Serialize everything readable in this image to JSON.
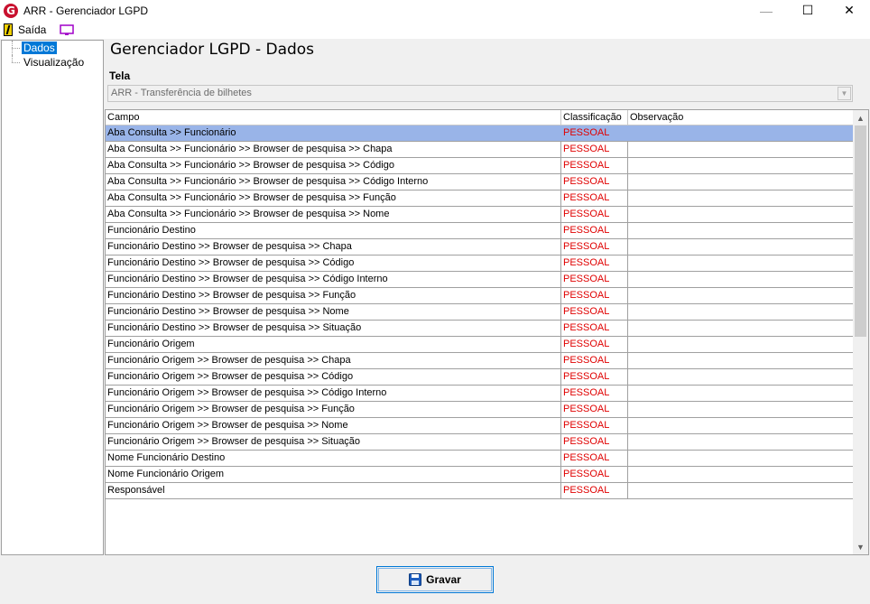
{
  "window": {
    "title": "ARR - Gerenciador LGPD",
    "logo_letter": "G",
    "controls": {
      "minimize": "—",
      "maximize": "☐",
      "close": "✕"
    }
  },
  "menu": {
    "items": [
      {
        "label": "Saída",
        "icon": "exit-icon"
      },
      {
        "label": "",
        "icon": "monitor-icon"
      }
    ]
  },
  "tree": {
    "items": [
      {
        "label": "Dados",
        "selected": true
      },
      {
        "label": "Visualização",
        "selected": false
      }
    ]
  },
  "main": {
    "title": "Gerenciador LGPD - Dados",
    "tela_label": "Tela",
    "tela_value": "ARR - Transferência de bilhetes"
  },
  "grid": {
    "columns": [
      "Campo",
      "Classificação",
      "Observação"
    ],
    "rows": [
      {
        "campo": "Aba Consulta >> Funcionário",
        "classificacao": "PESSOAL",
        "observacao": "",
        "selected": true
      },
      {
        "campo": "Aba Consulta >> Funcionário >> Browser de pesquisa >> Chapa",
        "classificacao": "PESSOAL",
        "observacao": ""
      },
      {
        "campo": "Aba Consulta >> Funcionário >> Browser de pesquisa >> Código",
        "classificacao": "PESSOAL",
        "observacao": ""
      },
      {
        "campo": "Aba Consulta >> Funcionário >> Browser de pesquisa >> Código Interno",
        "classificacao": "PESSOAL",
        "observacao": ""
      },
      {
        "campo": "Aba Consulta >> Funcionário >> Browser de pesquisa >> Função",
        "classificacao": "PESSOAL",
        "observacao": ""
      },
      {
        "campo": "Aba Consulta >> Funcionário >> Browser de pesquisa >> Nome",
        "classificacao": "PESSOAL",
        "observacao": ""
      },
      {
        "campo": "Funcionário Destino",
        "classificacao": "PESSOAL",
        "observacao": ""
      },
      {
        "campo": "Funcionário Destino >> Browser de pesquisa >> Chapa",
        "classificacao": "PESSOAL",
        "observacao": ""
      },
      {
        "campo": "Funcionário Destino >> Browser de pesquisa >> Código",
        "classificacao": "PESSOAL",
        "observacao": ""
      },
      {
        "campo": "Funcionário Destino >> Browser de pesquisa >> Código Interno",
        "classificacao": "PESSOAL",
        "observacao": ""
      },
      {
        "campo": "Funcionário Destino >> Browser de pesquisa >> Função",
        "classificacao": "PESSOAL",
        "observacao": ""
      },
      {
        "campo": "Funcionário Destino >> Browser de pesquisa >> Nome",
        "classificacao": "PESSOAL",
        "observacao": ""
      },
      {
        "campo": "Funcionário Destino >> Browser de pesquisa >> Situação",
        "classificacao": "PESSOAL",
        "observacao": ""
      },
      {
        "campo": "Funcionário Origem",
        "classificacao": "PESSOAL",
        "observacao": ""
      },
      {
        "campo": "Funcionário Origem >> Browser de pesquisa >> Chapa",
        "classificacao": "PESSOAL",
        "observacao": ""
      },
      {
        "campo": "Funcionário Origem >> Browser de pesquisa >> Código",
        "classificacao": "PESSOAL",
        "observacao": ""
      },
      {
        "campo": "Funcionário Origem >> Browser de pesquisa >> Código Interno",
        "classificacao": "PESSOAL",
        "observacao": ""
      },
      {
        "campo": "Funcionário Origem >> Browser de pesquisa >> Função",
        "classificacao": "PESSOAL",
        "observacao": ""
      },
      {
        "campo": "Funcionário Origem >> Browser de pesquisa >> Nome",
        "classificacao": "PESSOAL",
        "observacao": ""
      },
      {
        "campo": "Funcionário Origem >> Browser de pesquisa >> Situação",
        "classificacao": "PESSOAL",
        "observacao": ""
      },
      {
        "campo": "Nome Funcionário Destino",
        "classificacao": "PESSOAL",
        "observacao": ""
      },
      {
        "campo": "Nome Funcionário Origem",
        "classificacao": "PESSOAL",
        "observacao": ""
      },
      {
        "campo": "Responsável",
        "classificacao": "PESSOAL",
        "observacao": ""
      }
    ]
  },
  "footer": {
    "save_label": "Gravar",
    "save_icon": "floppy-disk-icon"
  },
  "colors": {
    "selection": "#99b4e8",
    "tree_selection": "#0078d7",
    "classification_text": "#e00000"
  }
}
